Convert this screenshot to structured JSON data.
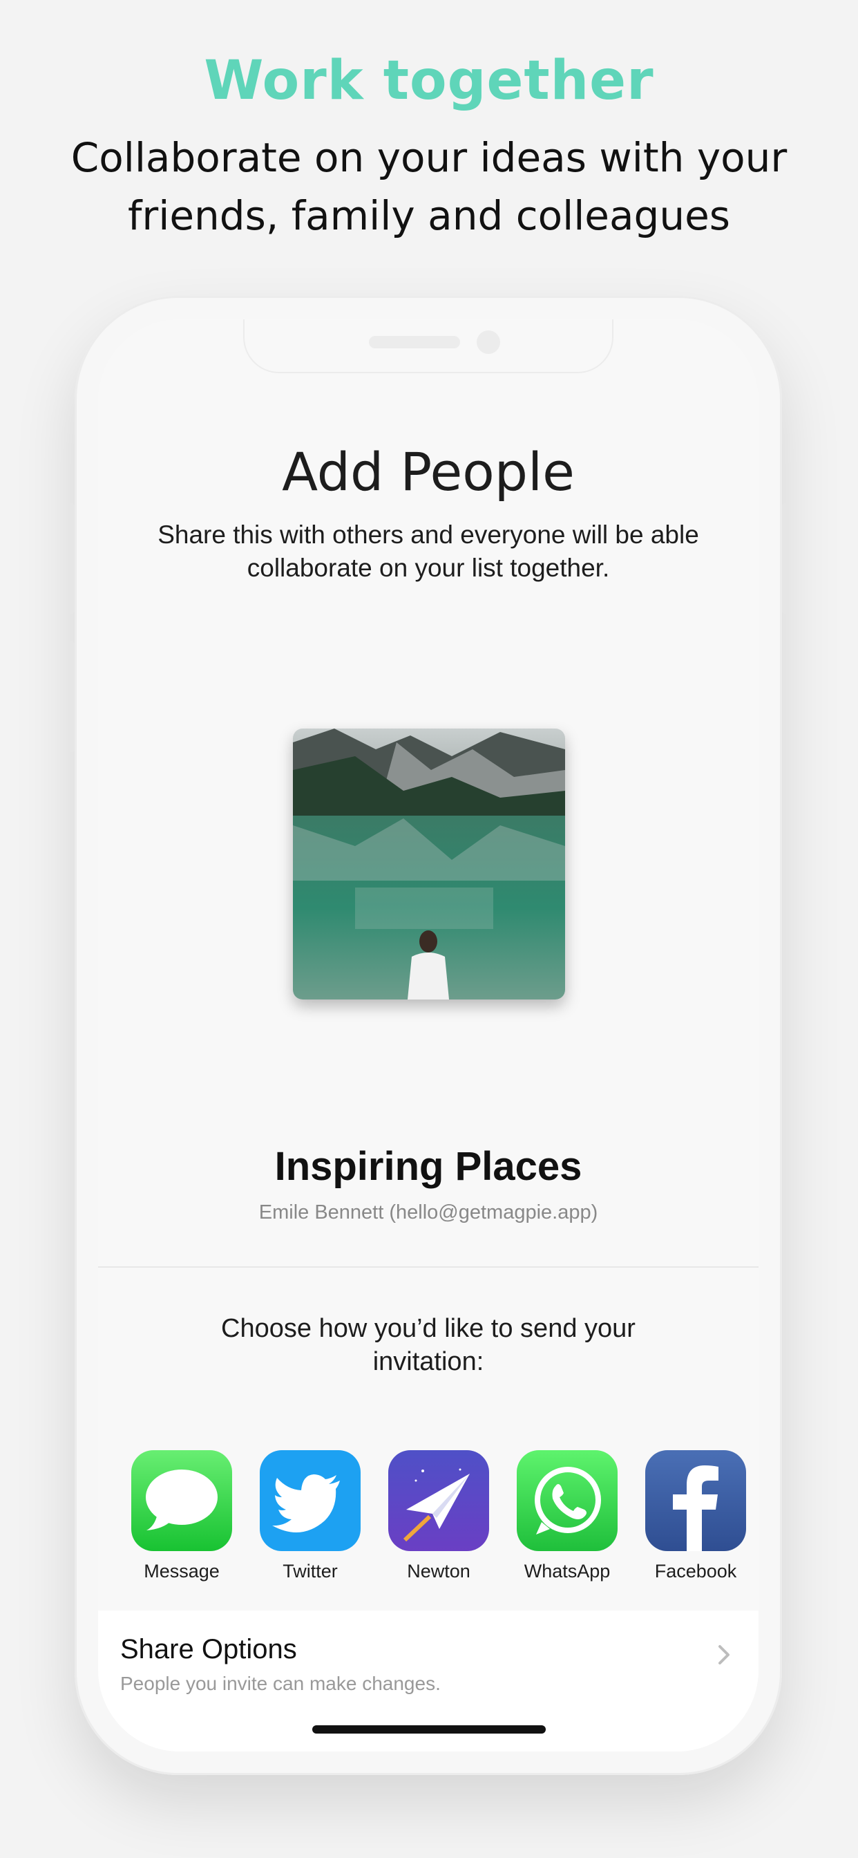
{
  "promo": {
    "headline": "Work together",
    "subline": "Collaborate on your ideas with your friends, family and colleagues"
  },
  "screen": {
    "title": "Add People",
    "description": "Share this with others and everyone will be able collaborate on your list together.",
    "list_title": "Inspiring Places",
    "list_owner": "Emile Bennett (hello@getmagpie.app)",
    "choose_text": "Choose how you’d like to send your invitation:",
    "apps": [
      {
        "label": "Message",
        "icon": "message-icon"
      },
      {
        "label": "Twitter",
        "icon": "twitter-icon"
      },
      {
        "label": "Newton",
        "icon": "newton-icon"
      },
      {
        "label": "WhatsApp",
        "icon": "whatsapp-icon"
      },
      {
        "label": "Facebook",
        "icon": "facebook-icon"
      }
    ],
    "share_options": {
      "title": "Share Options",
      "subtitle": "People you invite can make changes."
    }
  },
  "colors": {
    "accent": "#5fd5b9",
    "message": "#2fd64a",
    "twitter": "#1da1f2",
    "newton": "#5b47c8",
    "whatsapp": "#25d366",
    "facebook": "#3b5998"
  }
}
